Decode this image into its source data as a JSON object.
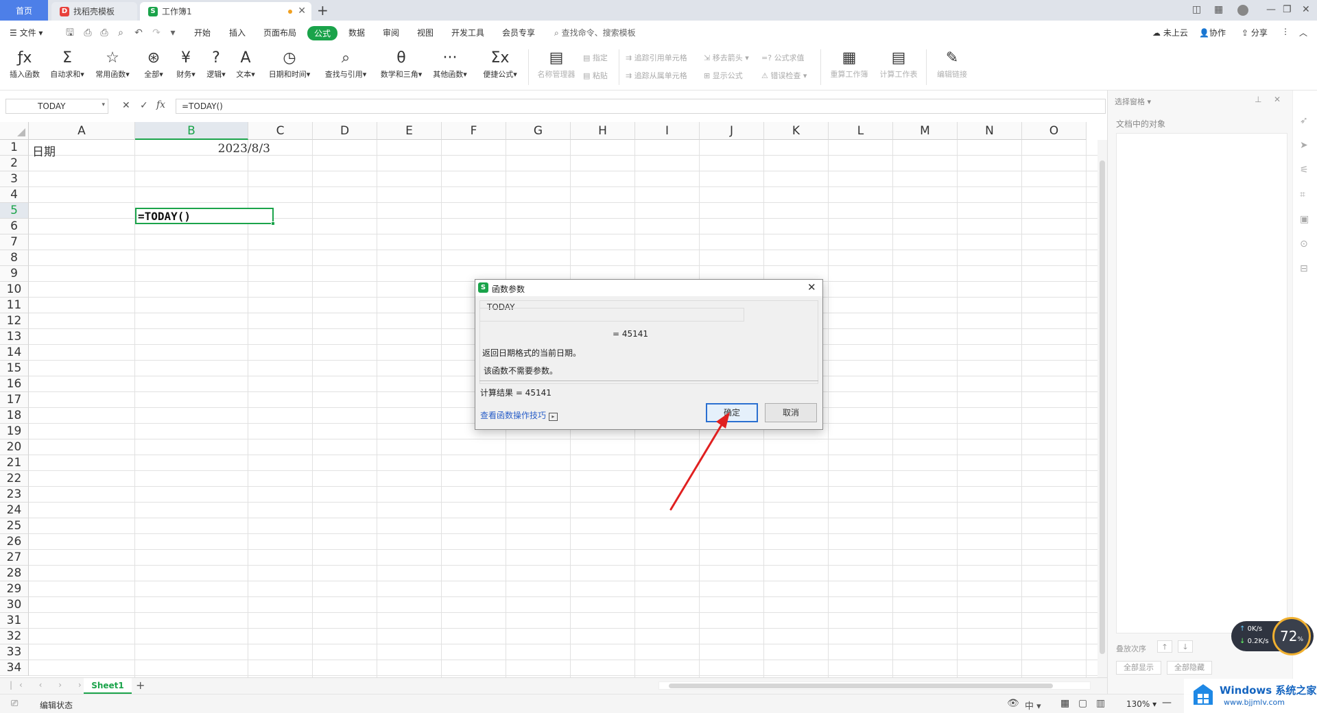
{
  "tabs": {
    "home": "首页",
    "template": "找稻壳模板",
    "workbook": "工作簿1",
    "new_tab": "+"
  },
  "menubar": {
    "file": "文件",
    "items": [
      "开始",
      "插入",
      "页面布局",
      "公式",
      "数据",
      "审阅",
      "视图",
      "开发工具",
      "会员专享"
    ],
    "active_index": 3,
    "search": "查找命令、搜索模板",
    "cloud": "未上云",
    "collab": "协作",
    "share": "分享"
  },
  "ribbon": {
    "buttons": [
      {
        "label": "插入函数",
        "icon": "fx-icon",
        "glyph": "ƒx"
      },
      {
        "label": "自动求和",
        "icon": "sigma-icon",
        "glyph": "Σ"
      },
      {
        "label": "常用函数",
        "icon": "star-icon",
        "glyph": "☆"
      },
      {
        "label": "全部",
        "icon": "asterisk-icon",
        "glyph": "⊛"
      },
      {
        "label": "财务",
        "icon": "yen-icon",
        "glyph": "¥"
      },
      {
        "label": "逻辑",
        "icon": "question-icon",
        "glyph": "?"
      },
      {
        "label": "文本",
        "icon": "text-a-icon",
        "glyph": "A"
      },
      {
        "label": "日期和时间",
        "icon": "clock-icon",
        "glyph": "◷"
      },
      {
        "label": "查找与引用",
        "icon": "magnifier-icon",
        "glyph": "⌕"
      },
      {
        "label": "数学和三角",
        "icon": "theta-icon",
        "glyph": "θ"
      },
      {
        "label": "其他函数",
        "icon": "dots-icon",
        "glyph": "···"
      },
      {
        "label": "便捷公式",
        "icon": "formula-icon",
        "glyph": "Σx"
      }
    ],
    "name_manager": "名称管理器",
    "assign": "指定",
    "paste": "粘贴",
    "trace_precedents": "追踪引用单元格",
    "trace_dependents": "追踪从属单元格",
    "remove_arrows": "移去箭头",
    "show_formulas": "显示公式",
    "evaluate": "公式求值",
    "error_check": "错误检查",
    "recalc_book": "重算工作簿",
    "calc_sheet": "计算工作表",
    "edit_links": "编辑链接"
  },
  "formulabar": {
    "namebox": "TODAY",
    "fx": "fx",
    "formula": "=TODAY()"
  },
  "grid": {
    "columns": [
      "A",
      "B",
      "C",
      "D",
      "E",
      "F",
      "G",
      "H",
      "I",
      "J",
      "K",
      "L",
      "M",
      "N",
      "O"
    ],
    "selected_column": "B",
    "selected_row": "5",
    "rows": [
      "1",
      "2",
      "3",
      "4",
      "5",
      "6",
      "7",
      "8",
      "9",
      "10",
      "11",
      "12",
      "13",
      "14",
      "15",
      "16",
      "17",
      "18",
      "19",
      "20",
      "21",
      "22",
      "23",
      "24",
      "25",
      "26",
      "27",
      "28",
      "29",
      "30",
      "31",
      "32",
      "33",
      "34"
    ],
    "a1": "日期",
    "b1": "2023/8/3",
    "b5": "=TODAY()"
  },
  "sheetbar": {
    "sheet": "Sheet1",
    "add": "+"
  },
  "statusbar": {
    "mode": "编辑状态",
    "zoom": "130%",
    "ime": "中"
  },
  "rightpane": {
    "title": "选择窗格",
    "objects": "文档中的对象",
    "order": "叠放次序",
    "show_all": "全部显示",
    "hide_all": "全部隐藏"
  },
  "netmeter": {
    "up": "0K/s",
    "down": "0.2K/s",
    "percent": "72"
  },
  "watermark": {
    "brand": "Windows 系统之家",
    "url": "www.bjjmlv.com"
  },
  "dialog": {
    "title": "函数参数",
    "fn_name": "TODAY",
    "result_line": "=  45141",
    "desc1": "返回日期格式的当前日期。",
    "desc2": "该函数不需要参数。",
    "calc_result": "计算结果  =  45141",
    "help_link": "查看函数操作技巧",
    "ok": "确定",
    "cancel": "取消"
  },
  "colors": {
    "accent": "#1aa34a",
    "home_tab": "#4d7fe8",
    "arrow": "#e02020"
  }
}
